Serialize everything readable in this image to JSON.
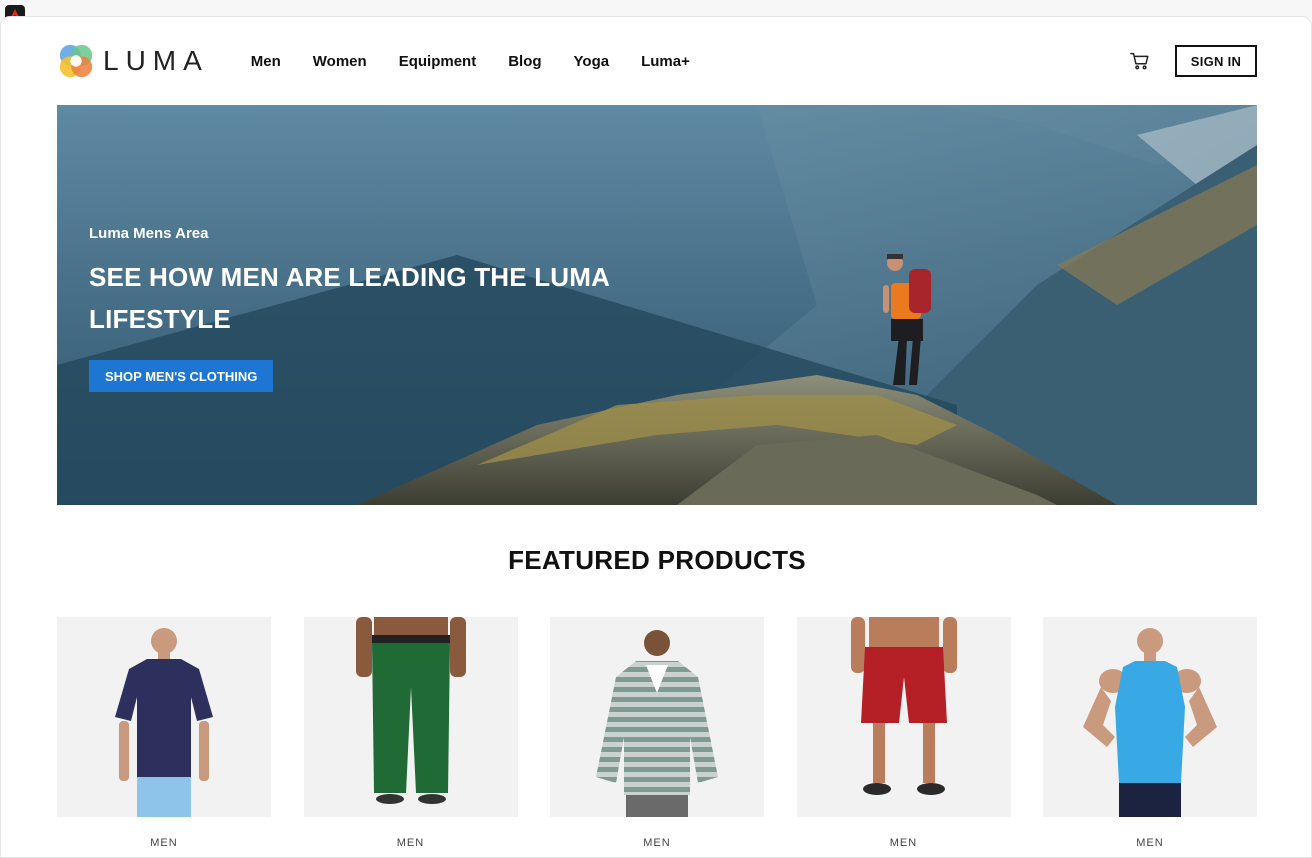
{
  "brand": {
    "name": "LUMA"
  },
  "nav": {
    "items": [
      {
        "label": "Men"
      },
      {
        "label": "Women"
      },
      {
        "label": "Equipment"
      },
      {
        "label": "Blog"
      },
      {
        "label": "Yoga"
      },
      {
        "label": "Luma+"
      }
    ]
  },
  "header": {
    "signin_label": "SIGN IN",
    "cart_icon": "cart-icon"
  },
  "hero": {
    "eyebrow": "Luma Mens Area",
    "title": "SEE HOW MEN ARE LEADING THE LUMA LIFESTYLE",
    "button_label": "SHOP MEN'S CLOTHING",
    "button_color": "#1d76d2"
  },
  "featured": {
    "title": "FEATURED PRODUCTS",
    "products": [
      {
        "category": "MEN",
        "garment": "t-shirt",
        "color": "#2d2f5c",
        "bottom_color": "#8ec3ea"
      },
      {
        "category": "MEN",
        "garment": "pants",
        "color": "#1f6a35"
      },
      {
        "category": "MEN",
        "garment": "hoodie",
        "color": "#7f9a92"
      },
      {
        "category": "MEN",
        "garment": "shorts",
        "color": "#b42025"
      },
      {
        "category": "MEN",
        "garment": "tank",
        "color": "#39a9e6",
        "bottom_color": "#1b2340"
      }
    ]
  }
}
